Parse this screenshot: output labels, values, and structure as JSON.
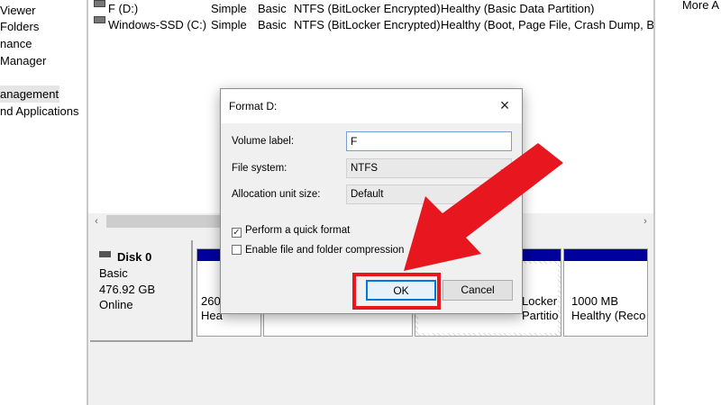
{
  "left_nav": {
    "items": [
      {
        "label": "Viewer"
      },
      {
        "label": " Folders"
      },
      {
        "label": "nance"
      },
      {
        "label": " Manager"
      },
      {
        "label": "anagement"
      },
      {
        "label": "nd Applications"
      }
    ],
    "selected_index": 4
  },
  "volume_list": {
    "rows": [
      {
        "name": "F (D:)",
        "layout": "Simple",
        "type": "Basic",
        "file_system": "NTFS (BitLocker Encrypted)",
        "status": "Healthy (Basic Data Partition)"
      },
      {
        "name": "Windows-SSD (C:)",
        "layout": "Simple",
        "type": "Basic",
        "file_system": "NTFS (BitLocker Encrypted)",
        "status": "Healthy (Boot, Page File, Crash Dump, Bas"
      }
    ]
  },
  "scrollbar": {
    "left_icon": "chevron-left-icon",
    "right_icon": "chevron-right-icon"
  },
  "disk": {
    "name": "Disk 0",
    "type": "Basic",
    "size": "476.92 GB",
    "status": "Online",
    "partitions": [
      {
        "line1": "260",
        "line2": "Hea"
      },
      {
        "line1": "",
        "line2": ""
      },
      {
        "line1": "Locker",
        "line2": "Partitio"
      },
      {
        "line1": "1000 MB",
        "line2": "Healthy (Reco"
      }
    ]
  },
  "actions": {
    "more_label": "More A"
  },
  "dialog": {
    "title": "Format D:",
    "close_icon": "close-icon",
    "volume_label": {
      "label": "Volume label:",
      "value": "F"
    },
    "file_system": {
      "label": "File system:",
      "value": "NTFS"
    },
    "allocation": {
      "label": "Allocation unit size:",
      "value": "Default"
    },
    "quick_format": {
      "label": "Perform a quick format",
      "checked": true
    },
    "compression": {
      "label": "Enable file and folder compression",
      "checked": false
    },
    "ok_label": "OK",
    "cancel_label": "Cancel"
  },
  "annotation": {
    "color": "#e8161e",
    "icon": "red-arrow-icon"
  },
  "colors": {
    "partition_band": "#00009c",
    "focus_blue": "#0078d7"
  }
}
